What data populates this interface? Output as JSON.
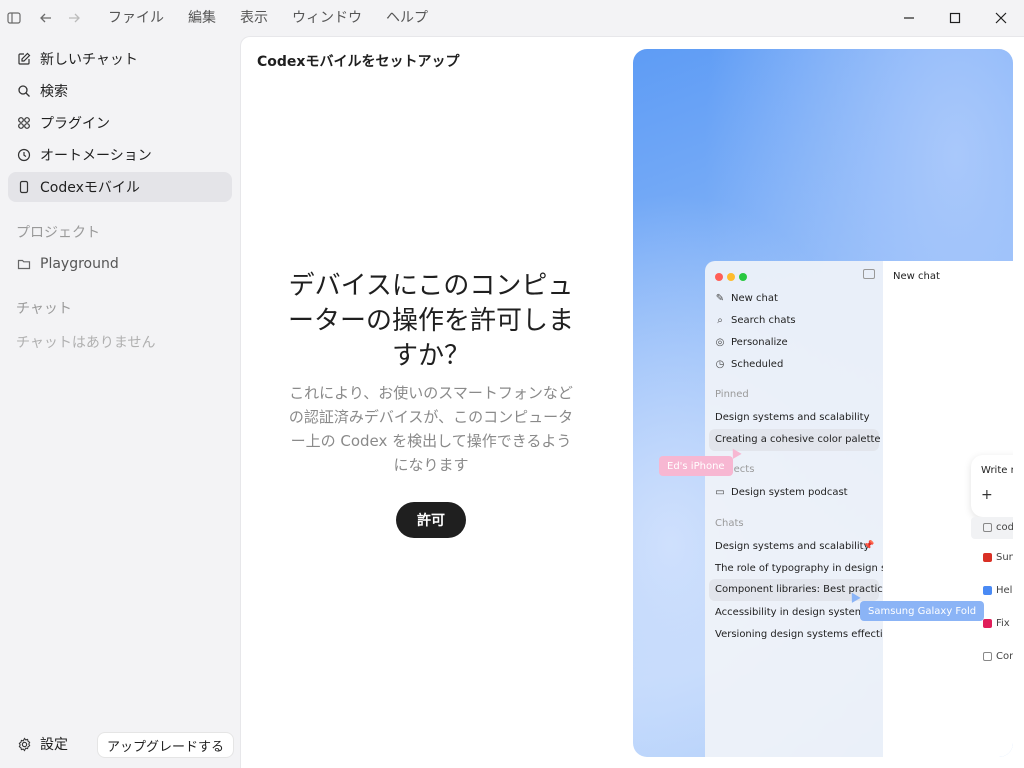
{
  "menu": [
    "ファイル",
    "編集",
    "表示",
    "ウィンドウ",
    "ヘルプ"
  ],
  "sidebar": {
    "nav": [
      {
        "label": "新しいチャット",
        "icon": "compose-icon"
      },
      {
        "label": "検索",
        "icon": "search-icon"
      },
      {
        "label": "プラグイン",
        "icon": "plugin-grid-icon"
      },
      {
        "label": "オートメーション",
        "icon": "clock-icon"
      },
      {
        "label": "Codexモバイル",
        "icon": "phone-icon",
        "active": true
      }
    ],
    "projects_heading": "プロジェクト",
    "projects": [
      {
        "label": "Playground",
        "icon": "folder-icon"
      }
    ],
    "chats_heading": "チャット",
    "chats_empty": "チャットはありません",
    "settings_label": "設定",
    "upgrade_label": "アップグレードする"
  },
  "main": {
    "title": "Codexモバイルをセットアップ",
    "hero_title": "デバイスにこのコンピューターの操作を許可しますか？",
    "hero_desc": "これにより、お使いのスマートフォンなどの認証済みデバイスが、このコンピューター上の Codex を検出して操作できるようになります",
    "allow_label": "許可"
  },
  "preview": {
    "newchat": "New chat",
    "nav": [
      "New chat",
      "Search chats",
      "Personalize",
      "Scheduled"
    ],
    "pinned_heading": "Pinned",
    "pinned": [
      "Design systems and scalability",
      "Creating a cohesive color palette"
    ],
    "projects_heading": "Projects",
    "projects": [
      "Design system podcast"
    ],
    "chats_heading": "Chats",
    "chats": [
      "Design systems and scalability",
      "The role of typography in design s...",
      "Component libraries: Best practices",
      "Accessibility in design systems",
      "Versioning design systems effecti..."
    ],
    "write_label": "Write m",
    "side_items": [
      "cod",
      "Sun",
      "Help",
      "Fix",
      "Con"
    ],
    "tag_iphone": "Ed's iPhone",
    "tag_galaxy": "Samsung Galaxy Fold",
    "colors": {
      "close": "#ff5f57",
      "minimize": "#febc2e",
      "zoom": "#28c840",
      "pink_tag": "#f7b7d2",
      "blue_tag": "#8bb4f6"
    }
  }
}
